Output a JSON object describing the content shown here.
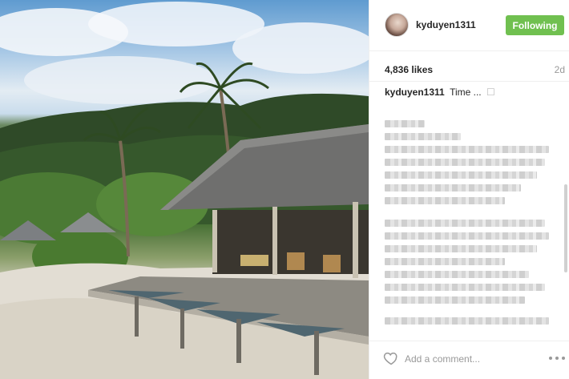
{
  "post": {
    "image_alt": "Thatched-roof pavilion with wooden deck on a beach, palm trees and green hills under a cloudy blue sky"
  },
  "header": {
    "username": "kyduyen1311",
    "follow_label": "Following"
  },
  "stats": {
    "likes": "4,836 likes",
    "time": "2d"
  },
  "caption": {
    "author": "kyduyen1311",
    "text": "Time ...",
    "mark": "☐"
  },
  "footer": {
    "comment_placeholder": "Add a comment...",
    "more_icon": "more-options-icon",
    "like_icon": "heart-icon"
  },
  "colors": {
    "follow_button": "#70c050",
    "text": "#262626",
    "muted": "#999999"
  }
}
